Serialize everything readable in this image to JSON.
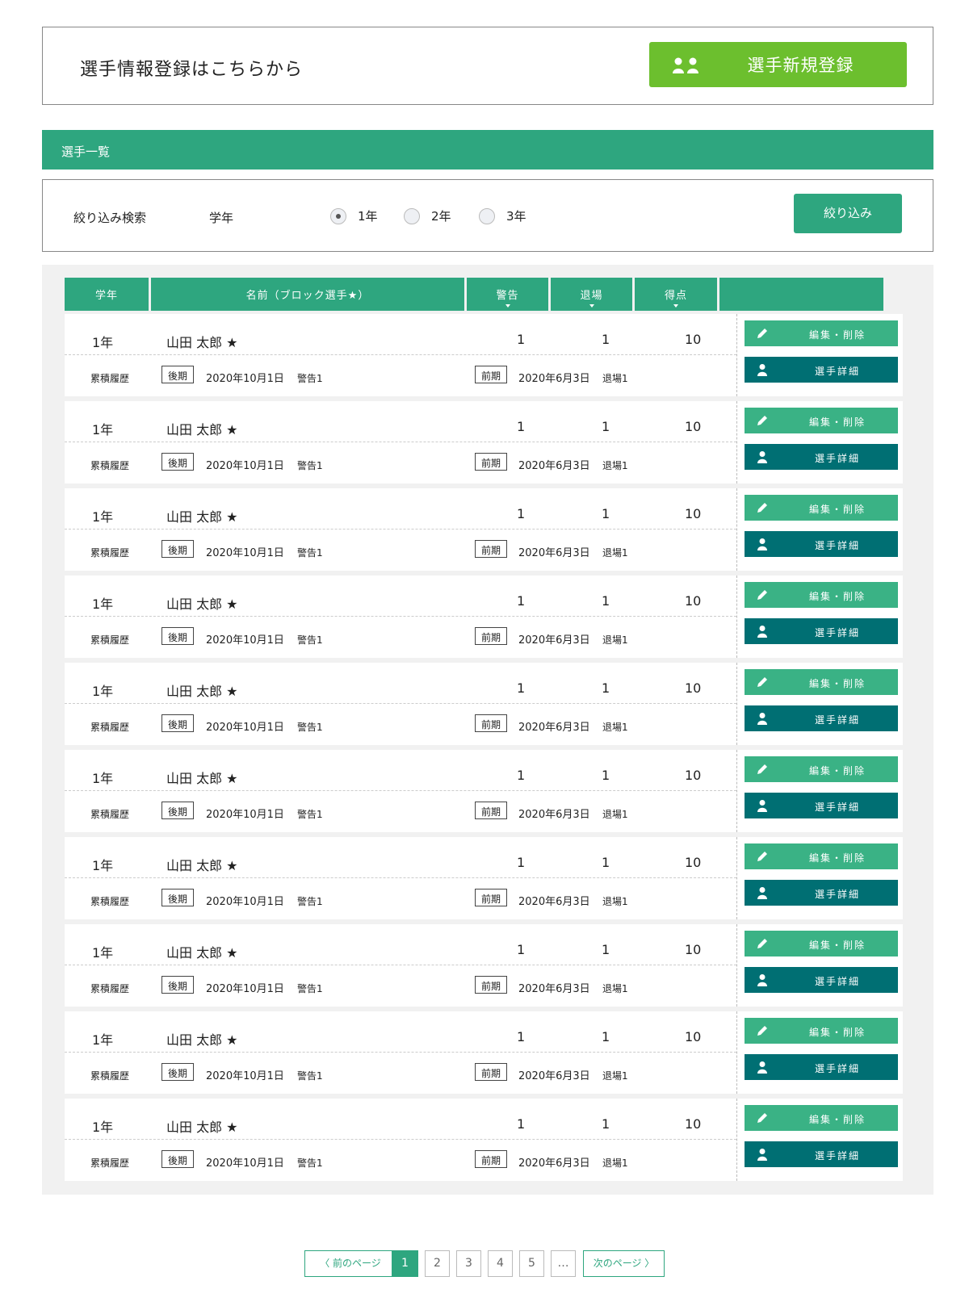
{
  "registration": {
    "text": "選手情報登録はこちらから",
    "button_label": "選手新規登録"
  },
  "section": {
    "title": "選手一覧"
  },
  "filter": {
    "label": "絞り込み検索",
    "grade_label": "学年",
    "options": [
      {
        "label": "1年",
        "checked": true
      },
      {
        "label": "2年",
        "checked": false
      },
      {
        "label": "3年",
        "checked": false
      }
    ],
    "button_label": "絞り込み"
  },
  "table": {
    "headers": {
      "grade": "学年",
      "name": "名前（ブロック選手★）",
      "warning": "警告",
      "exit": "退場",
      "score": "得点"
    },
    "rows": [
      {
        "grade": "1年",
        "name": "山田 太郎 ★",
        "warning": "1",
        "exit": "1",
        "score": "10",
        "history": "累積履歴",
        "tag1": "後期",
        "date1": "2020年10月1日",
        "note1": "警告1",
        "tag2": "前期",
        "date2": "2020年6月3日",
        "note2": "退場1"
      },
      {
        "grade": "1年",
        "name": "山田 太郎 ★",
        "warning": "1",
        "exit": "1",
        "score": "10",
        "history": "累積履歴",
        "tag1": "後期",
        "date1": "2020年10月1日",
        "note1": "警告1",
        "tag2": "前期",
        "date2": "2020年6月3日",
        "note2": "退場1"
      },
      {
        "grade": "1年",
        "name": "山田 太郎 ★",
        "warning": "1",
        "exit": "1",
        "score": "10",
        "history": "累積履歴",
        "tag1": "後期",
        "date1": "2020年10月1日",
        "note1": "警告1",
        "tag2": "前期",
        "date2": "2020年6月3日",
        "note2": "退場1"
      },
      {
        "grade": "1年",
        "name": "山田 太郎 ★",
        "warning": "1",
        "exit": "1",
        "score": "10",
        "history": "累積履歴",
        "tag1": "後期",
        "date1": "2020年10月1日",
        "note1": "警告1",
        "tag2": "前期",
        "date2": "2020年6月3日",
        "note2": "退場1"
      },
      {
        "grade": "1年",
        "name": "山田 太郎 ★",
        "warning": "1",
        "exit": "1",
        "score": "10",
        "history": "累積履歴",
        "tag1": "後期",
        "date1": "2020年10月1日",
        "note1": "警告1",
        "tag2": "前期",
        "date2": "2020年6月3日",
        "note2": "退場1"
      },
      {
        "grade": "1年",
        "name": "山田 太郎 ★",
        "warning": "1",
        "exit": "1",
        "score": "10",
        "history": "累積履歴",
        "tag1": "後期",
        "date1": "2020年10月1日",
        "note1": "警告1",
        "tag2": "前期",
        "date2": "2020年6月3日",
        "note2": "退場1"
      },
      {
        "grade": "1年",
        "name": "山田 太郎 ★",
        "warning": "1",
        "exit": "1",
        "score": "10",
        "history": "累積履歴",
        "tag1": "後期",
        "date1": "2020年10月1日",
        "note1": "警告1",
        "tag2": "前期",
        "date2": "2020年6月3日",
        "note2": "退場1"
      },
      {
        "grade": "1年",
        "name": "山田 太郎 ★",
        "warning": "1",
        "exit": "1",
        "score": "10",
        "history": "累積履歴",
        "tag1": "後期",
        "date1": "2020年10月1日",
        "note1": "警告1",
        "tag2": "前期",
        "date2": "2020年6月3日",
        "note2": "退場1"
      },
      {
        "grade": "1年",
        "name": "山田 太郎 ★",
        "warning": "1",
        "exit": "1",
        "score": "10",
        "history": "累積履歴",
        "tag1": "後期",
        "date1": "2020年10月1日",
        "note1": "警告1",
        "tag2": "前期",
        "date2": "2020年6月3日",
        "note2": "退場1"
      },
      {
        "grade": "1年",
        "name": "山田 太郎 ★",
        "warning": "1",
        "exit": "1",
        "score": "10",
        "history": "累積履歴",
        "tag1": "後期",
        "date1": "2020年10月1日",
        "note1": "警告1",
        "tag2": "前期",
        "date2": "2020年6月3日",
        "note2": "退場1"
      }
    ],
    "edit_label": "編集・削除",
    "detail_label": "選手詳細"
  },
  "pagination": {
    "prev": "前のページ",
    "pages": [
      "1",
      "2",
      "3",
      "4",
      "5"
    ],
    "active": "1",
    "ellipsis": "…",
    "next": "次のページ"
  },
  "colors": {
    "primary_green": "#2ea67f",
    "register_green": "#6cbf2e",
    "detail_teal": "#006f73",
    "edit_green": "#3ab285"
  }
}
